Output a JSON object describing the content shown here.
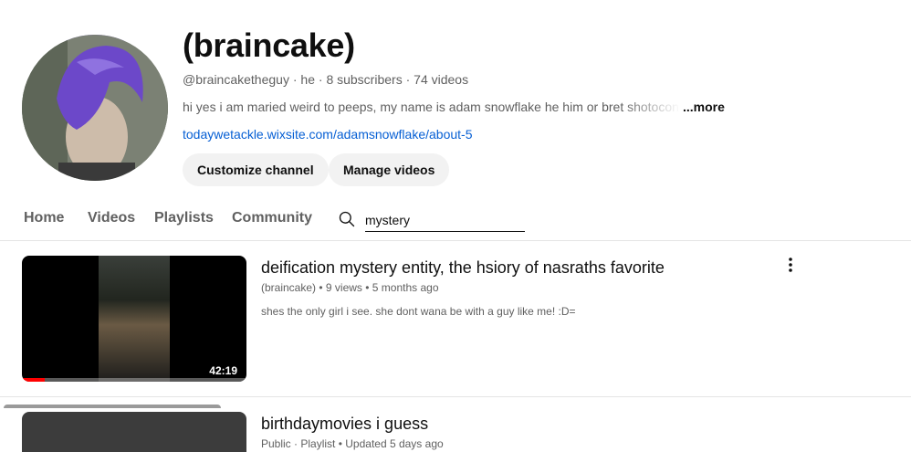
{
  "channel": {
    "name": "(braincake)",
    "handle": "@braincaketheguy",
    "pronouns": "he",
    "subscribers": "8 subscribers",
    "video_count": "74 videos",
    "description": "hi yes i am maried weird to peeps, my name is adam snowflake he him or bret shotocon a",
    "more_label": "...more",
    "link": "todaywetackle.wixsite.com/adamsnowflake/about-5"
  },
  "buttons": {
    "customize": "Customize channel",
    "manage": "Manage videos"
  },
  "tabs": [
    {
      "label": "Home"
    },
    {
      "label": "Videos"
    },
    {
      "label": "Playlists"
    },
    {
      "label": "Community"
    }
  ],
  "search": {
    "value": "mystery"
  },
  "results": [
    {
      "title": "deification mystery entity, the hsiory of nasraths favorite",
      "channel": "(braincake)",
      "views": "9 views",
      "age": "5 months ago",
      "description": "shes the only girl i see. she dont wana be with a guy like me! :D=",
      "duration": "42:19",
      "watched_fraction": 0.1
    },
    {
      "title": "birthdaymovies i guess",
      "visibility": "Public",
      "kind": "Playlist",
      "updated": "Updated 5 days ago"
    }
  ],
  "colors": {
    "link": "#065fd4",
    "progress": "#ff0000",
    "button_bg": "#f2f2f2"
  }
}
